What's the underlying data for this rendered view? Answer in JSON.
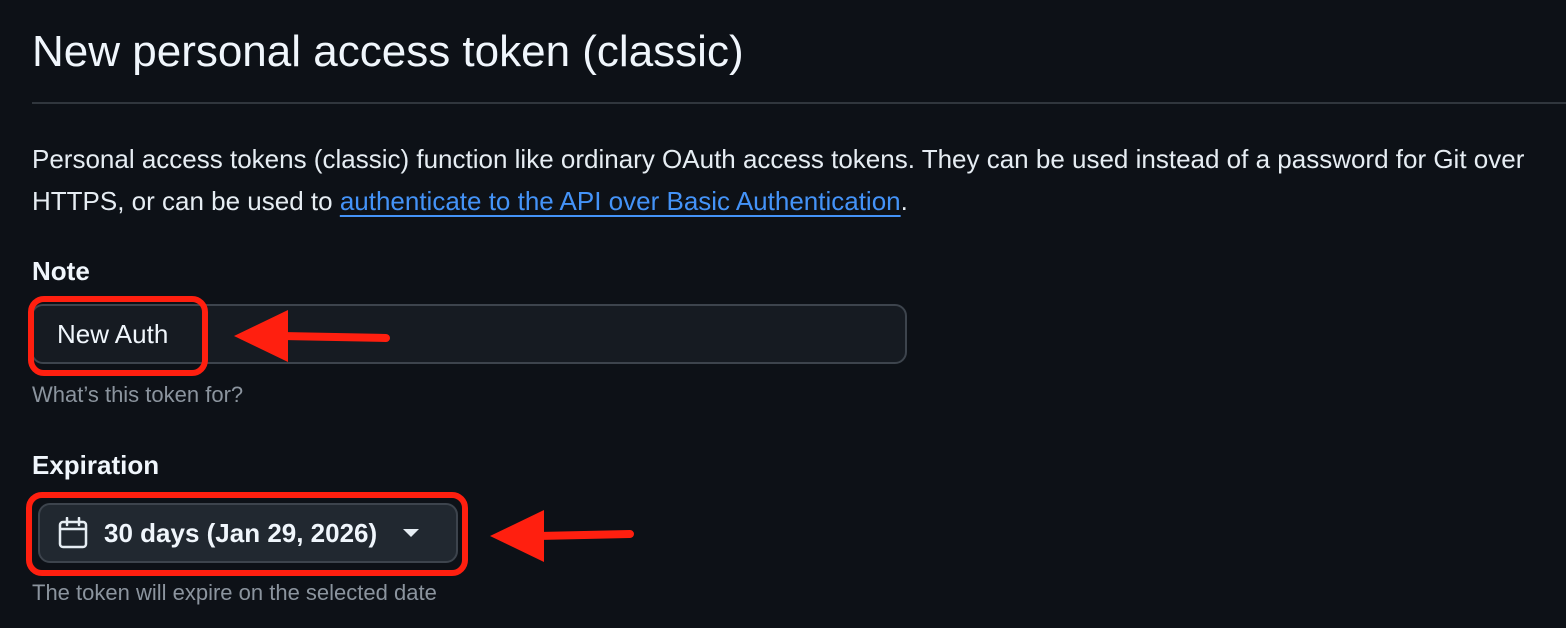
{
  "page": {
    "title": "New personal access token (classic)"
  },
  "intro": {
    "text_before": "Personal access tokens (classic) function like ordinary OAuth access tokens. They can be used instead of a password for Git over HTTPS, or can be used to ",
    "link_text": "authenticate to the API over Basic Authentication",
    "text_after": "."
  },
  "note": {
    "label": "Note",
    "value": "New Auth",
    "hint": "What’s this token for?"
  },
  "expiration": {
    "label": "Expiration",
    "selected": "30 days (Jan 29, 2026)",
    "hint": "The token will expire on the selected date",
    "icon": "calendar-icon"
  },
  "annotations": {
    "highlight_color": "#ff1f0f",
    "link_color": "#4493f8",
    "background_color": "#0d1117"
  }
}
